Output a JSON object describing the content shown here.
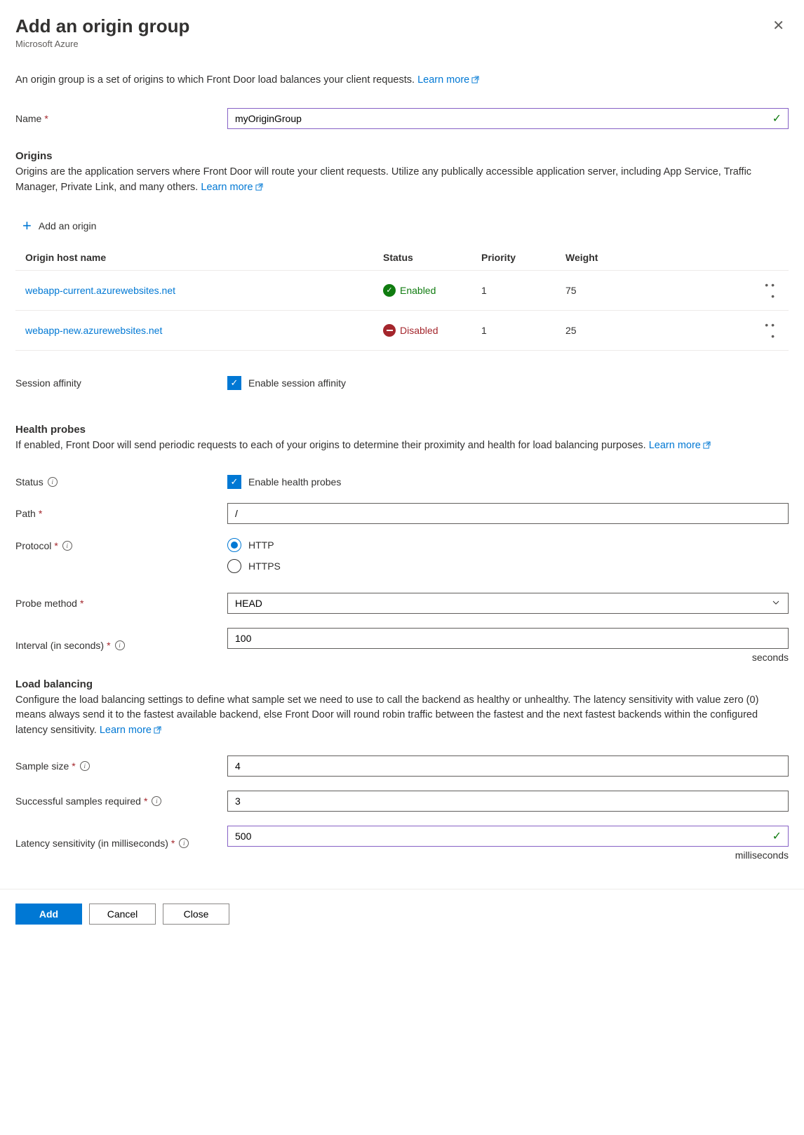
{
  "header": {
    "title": "Add an origin group",
    "subtitle": "Microsoft Azure"
  },
  "intro": {
    "text": "An origin group is a set of origins to which Front Door load balances your client requests. ",
    "learn_more": "Learn more"
  },
  "name_field": {
    "label": "Name",
    "value": "myOriginGroup"
  },
  "origins": {
    "title": "Origins",
    "desc": "Origins are the application servers where Front Door will route your client requests. Utilize any publically accessible application server, including App Service, Traffic Manager, Private Link, and many others. ",
    "learn_more": "Learn more",
    "add_label": "Add an origin",
    "columns": {
      "host": "Origin host name",
      "status": "Status",
      "priority": "Priority",
      "weight": "Weight"
    },
    "rows": [
      {
        "host": "webapp-current.azurewebsites.net",
        "status": "Enabled",
        "priority": "1",
        "weight": "75"
      },
      {
        "host": "webapp-new.azurewebsites.net",
        "status": "Disabled",
        "priority": "1",
        "weight": "25"
      }
    ]
  },
  "session_affinity": {
    "label": "Session affinity",
    "checkbox_label": "Enable session affinity"
  },
  "health_probes": {
    "title": "Health probes",
    "desc": "If enabled, Front Door will send periodic requests to each of your origins to determine their proximity and health for load balancing purposes. ",
    "learn_more": "Learn more",
    "status_label": "Status",
    "status_checkbox": "Enable health probes",
    "path_label": "Path",
    "path_value": "/",
    "protocol_label": "Protocol",
    "protocol_options": {
      "http": "HTTP",
      "https": "HTTPS"
    },
    "method_label": "Probe method",
    "method_value": "HEAD",
    "interval_label": "Interval (in seconds)",
    "interval_value": "100",
    "interval_unit": "seconds"
  },
  "load_balancing": {
    "title": "Load balancing",
    "desc": "Configure the load balancing settings to define what sample set we need to use to call the backend as healthy or unhealthy. The latency sensitivity with value zero (0) means always send it to the fastest available backend, else Front Door will round robin traffic between the fastest and the next fastest backends within the configured latency sensitivity. ",
    "learn_more": "Learn more",
    "sample_label": "Sample size",
    "sample_value": "4",
    "success_label": "Successful samples required",
    "success_value": "3",
    "latency_label": "Latency sensitivity (in milliseconds)",
    "latency_value": "500",
    "latency_unit": "milliseconds"
  },
  "footer": {
    "add": "Add",
    "cancel": "Cancel",
    "close": "Close"
  }
}
